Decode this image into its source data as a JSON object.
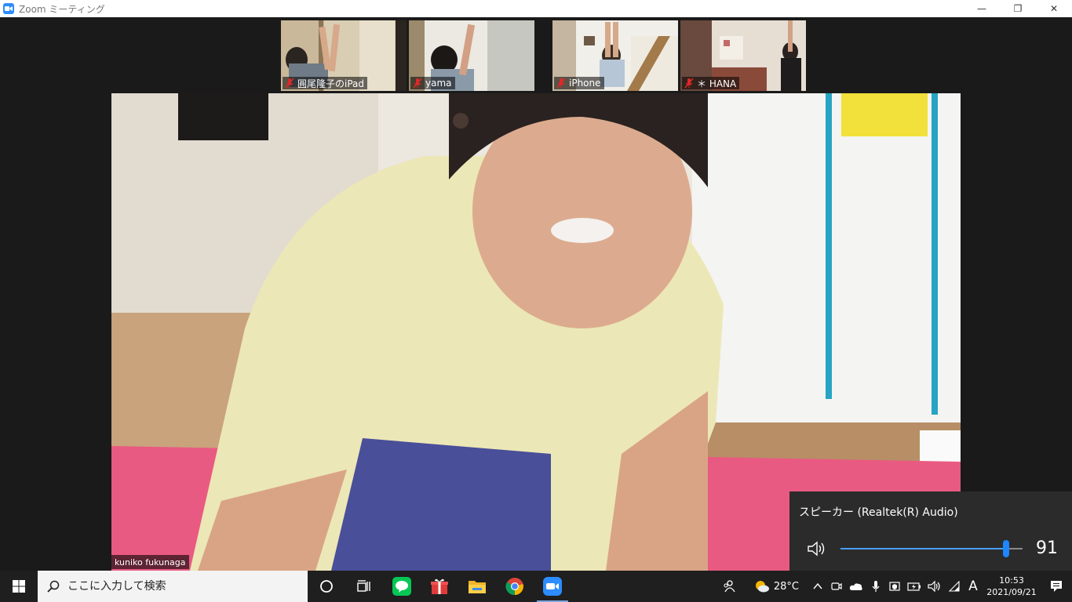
{
  "window": {
    "title": "Zoom ミーティング",
    "minimize_glyph": "—",
    "restore_glyph": "❐",
    "close_glyph": "✕"
  },
  "participants": [
    {
      "name": "圓尾隆子のiPad",
      "muted": true
    },
    {
      "name": "yama",
      "muted": true
    },
    {
      "name": "iPhone",
      "muted": true
    },
    {
      "name": "＊ HANA",
      "muted": true
    }
  ],
  "active_speaker": {
    "name": "kuniko fukunaga"
  },
  "volume_flyout": {
    "device": "スピーカー (Realtek(R) Audio)",
    "value": "91",
    "level": 0.91
  },
  "taskbar": {
    "search_placeholder": "ここに入力して検索",
    "apps": [
      "cortana-icon",
      "task-view-icon",
      "line-icon",
      "gift-icon",
      "file-explorer-icon",
      "chrome-icon",
      "zoom-icon"
    ],
    "weather_temp": "28°C",
    "ime_mode": "A",
    "time": "10:53",
    "date": "2021/09/21"
  },
  "colors": {
    "accent": "#1e86ff",
    "zoom_blue": "#2d8cff",
    "mic_muted": "#e02828",
    "line_green": "#06c755"
  }
}
